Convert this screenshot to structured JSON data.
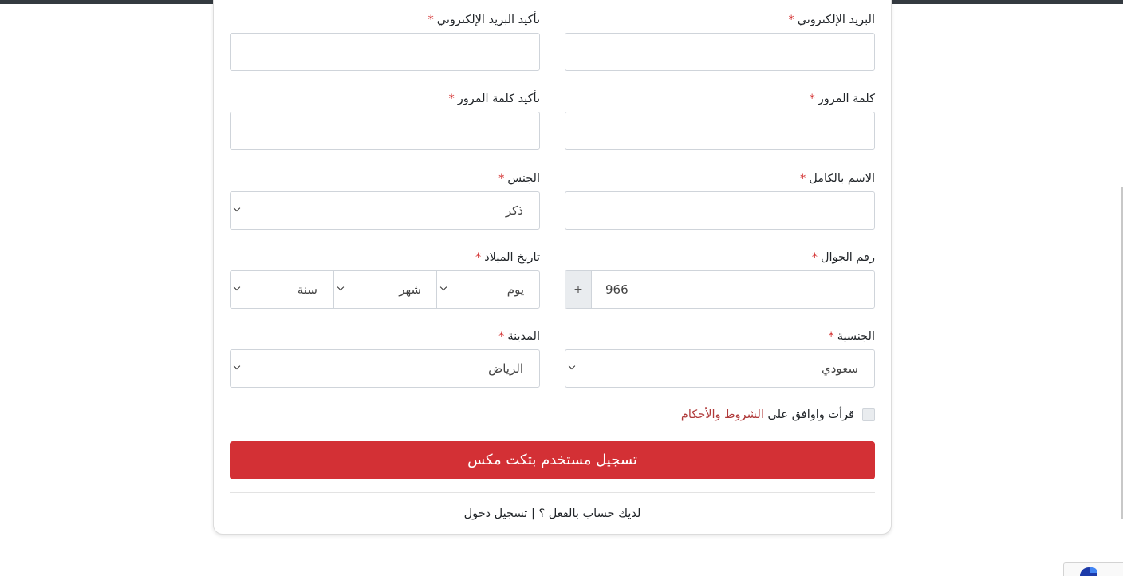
{
  "form": {
    "email": {
      "label": "البريد الإلكتروني",
      "value": ""
    },
    "email_confirm": {
      "label": "تأكيد البريد الإلكتروني",
      "value": ""
    },
    "password": {
      "label": "كلمة المرور",
      "value": ""
    },
    "password_confirm": {
      "label": "تأكيد كلمة المرور",
      "value": ""
    },
    "full_name": {
      "label": "الاسم بالكامل",
      "value": ""
    },
    "gender": {
      "label": "الجنس",
      "selected": "ذكر"
    },
    "mobile": {
      "label": "رقم الجوال",
      "prefix": "+",
      "value": "966"
    },
    "birth_date": {
      "label": "تاريخ الميلاد",
      "day": "يوم",
      "month": "شهر",
      "year": "سنة"
    },
    "nationality": {
      "label": "الجنسية",
      "selected": "سعودي"
    },
    "city": {
      "label": "المدينة",
      "selected": "الرياض"
    },
    "required_mark": "*"
  },
  "agreement": {
    "prefix": "قرأت واوافق على",
    "link": "الشروط والأحكام",
    "checked": false
  },
  "submit_label": "تسجيل مستخدم بتكت مكس",
  "login": {
    "prompt": "لديك حساب بالفعل ؟",
    "separator": "|",
    "link": "تسجيل دخول"
  },
  "colors": {
    "accent": "#d33035",
    "required": "#d32f2f",
    "link": "#b03a3a"
  }
}
